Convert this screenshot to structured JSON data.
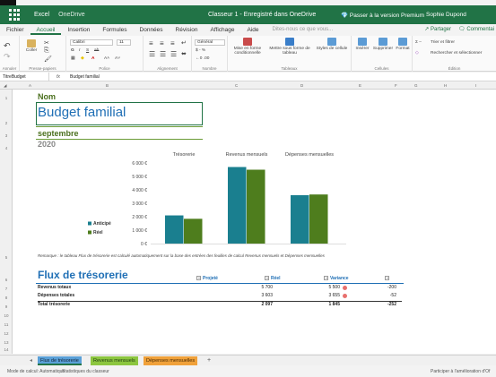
{
  "titlebar": {
    "app": "Excel",
    "location": "OneDrive",
    "document": "Classeur 1  -  Enregistré dans OneDrive",
    "premium": "Passer à la version Premium",
    "user": "Sophie Dupond"
  },
  "ribbon_tabs": [
    "Fichier",
    "Accueil",
    "Insertion",
    "Formules",
    "Données",
    "Révision",
    "Affichage",
    "Aide"
  ],
  "active_tab": "Accueil",
  "search_placeholder": "Dites-nous ce que vous...",
  "share_label": "Partager",
  "comments_label": "Commentai",
  "ribbon": {
    "undo_label": "Annuler",
    "paste_label": "Coller",
    "clipboard_label": "Presse-papiers",
    "font_name": "Calibri",
    "font_size": "11",
    "font_label": "Police",
    "alignment_label": "Alignement",
    "number_format": "Général",
    "currency_symbol": "$ - %",
    "number_label": "Nombre",
    "cond_format_label": "Mise en forme conditionnelle",
    "table_format_label": "Mettre sous forme de tableau",
    "cell_styles_label": "Styles de cellule",
    "tables_label": "Tableaux",
    "insert_label": "Insérer",
    "delete_label": "Supprimer",
    "format_label": "Format",
    "cells_label": "Cellules",
    "sort_label": "Trier et filtrer",
    "find_label": "Rechercher et sélectionner",
    "editing_label": "Édition"
  },
  "formula_bar": {
    "name_box": "TitreBudget",
    "fx": "fx",
    "content": "Budget familial"
  },
  "columns": [
    "A",
    "B",
    "C",
    "D",
    "E",
    "F",
    "G",
    "H",
    "I"
  ],
  "rows": [
    "1",
    "2",
    "3",
    "4",
    "5",
    "6",
    "7",
    "8",
    "9",
    "10",
    "11",
    "12",
    "13",
    "14"
  ],
  "sheet": {
    "nom": "Nom",
    "title": "Budget familial",
    "month": "septembre",
    "year": "2020",
    "remark": "Remarque : le tableau Flux de trésorerie est calculé automatiquement sur la base des entrées des feuilles de calcul Revenus mensuels et Dépenses mensuelles",
    "flux_title": "Flux de trésorerie"
  },
  "chart_data": {
    "type": "bar",
    "categories": [
      "Trésorerie",
      "Revenus mensuels",
      "Dépenses mensuelles"
    ],
    "series": [
      {
        "name": "Anticipé",
        "values": [
          2097,
          5700,
          3603
        ],
        "color": "#1a7f8f"
      },
      {
        "name": "Réel",
        "values": [
          1845,
          5500,
          3655
        ],
        "color": "#4e7d1d"
      }
    ],
    "y_ticks": [
      "0 €",
      "1 000 €",
      "2 000 €",
      "3 000 €",
      "4 000 €",
      "5 000 €",
      "6 000 €"
    ],
    "ylim": [
      0,
      6000
    ],
    "legend_position": "left",
    "grid": false
  },
  "flux_table": {
    "headers": [
      "Projeté",
      "Réel",
      "Variance"
    ],
    "rows": [
      {
        "label": "Revenus totaux",
        "projete": "5 700",
        "reel": "5 500",
        "variance": "-200",
        "warn": true
      },
      {
        "label": "Dépenses totales",
        "projete": "3 603",
        "reel": "3 655",
        "variance": "-52",
        "warn": true
      },
      {
        "label": "Total trésorerie",
        "projete": "2 097",
        "reel": "1 845",
        "variance": "-252",
        "warn": false
      }
    ]
  },
  "sheet_tabs": [
    "Flux de trésorerie",
    "Revenus mensuels",
    "Dépenses mensuelles"
  ],
  "add_sheet": "+",
  "statusbar": {
    "mode": "Mode de calcul: Automatique",
    "stats": "Statistiques du classeur",
    "feedback": "Participer à l'amélioration d'Of"
  }
}
